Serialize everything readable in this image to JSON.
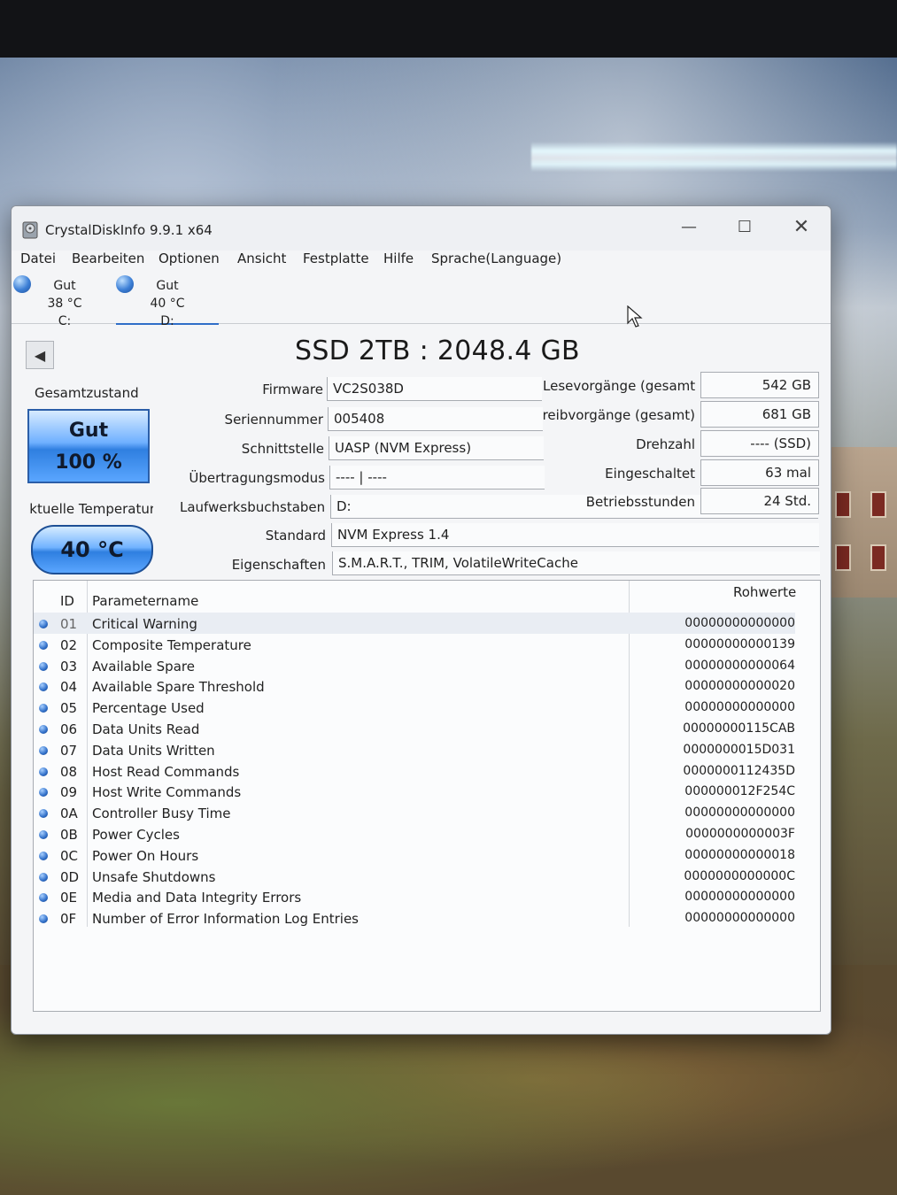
{
  "window": {
    "title": "CrystalDiskInfo 9.9.1 x64"
  },
  "controls": {
    "minimize": "—",
    "maximize": "☐",
    "close": "✕"
  },
  "menu": [
    "Datei",
    "Bearbeiten",
    "Optionen",
    "Ansicht",
    "Festplatte",
    "Hilfe",
    "Sprache(Language)"
  ],
  "drives": [
    {
      "status": "Gut",
      "temp": "38 °C",
      "letter": "C:"
    },
    {
      "status": "Gut",
      "temp": "40 °C",
      "letter": "D:"
    }
  ],
  "disk": {
    "title": "SSD 2TB : 2048.4 GB"
  },
  "health": {
    "label": "Gesamtzustand",
    "status": "Gut",
    "percent": "100 %"
  },
  "temperature": {
    "label": "Aktuelle Temperatur",
    "value": "40 °C"
  },
  "info_left": [
    {
      "label": "Firmware",
      "value": "VC2S038D"
    },
    {
      "label": "Seriennummer",
      "value": "005408"
    },
    {
      "label": "Schnittstelle",
      "value": "UASP (NVM Express)"
    },
    {
      "label": "Übertragungsmodus",
      "value": "---- | ----"
    },
    {
      "label": "Laufwerksbuchstaben",
      "value": "D:"
    },
    {
      "label": "Standard",
      "value": "NVM Express 1.4"
    },
    {
      "label": "Eigenschaften",
      "value": "S.M.A.R.T., TRIM, VolatileWriteCache"
    }
  ],
  "info_right": [
    {
      "label": "Lesevorgänge (gesamt)",
      "value": "542 GB"
    },
    {
      "label": "Schreibvorgänge (gesamt)",
      "value": "681 GB"
    },
    {
      "label": "Drehzahl",
      "value": "---- (SSD)"
    },
    {
      "label": "Eingeschaltet",
      "value": "63 mal"
    },
    {
      "label": "Betriebsstunden",
      "value": "24 Std."
    }
  ],
  "smart": {
    "headers": {
      "id": "ID",
      "name": "Parametername",
      "raw": "Rohwerte"
    },
    "rows": [
      {
        "id": "01",
        "name": "Critical Warning",
        "raw": "00000000000000"
      },
      {
        "id": "02",
        "name": "Composite Temperature",
        "raw": "00000000000139"
      },
      {
        "id": "03",
        "name": "Available Spare",
        "raw": "00000000000064"
      },
      {
        "id": "04",
        "name": "Available Spare Threshold",
        "raw": "00000000000020"
      },
      {
        "id": "05",
        "name": "Percentage Used",
        "raw": "00000000000000"
      },
      {
        "id": "06",
        "name": "Data Units Read",
        "raw": "00000000115CAB"
      },
      {
        "id": "07",
        "name": "Data Units Written",
        "raw": "0000000015D031"
      },
      {
        "id": "08",
        "name": "Host Read Commands",
        "raw": "0000000112435D"
      },
      {
        "id": "09",
        "name": "Host Write Commands",
        "raw": "000000012F254C"
      },
      {
        "id": "0A",
        "name": "Controller Busy Time",
        "raw": "00000000000000"
      },
      {
        "id": "0B",
        "name": "Power Cycles",
        "raw": "0000000000003F"
      },
      {
        "id": "0C",
        "name": "Power On Hours",
        "raw": "00000000000018"
      },
      {
        "id": "0D",
        "name": "Unsafe Shutdowns",
        "raw": "0000000000000C"
      },
      {
        "id": "0E",
        "name": "Media and Data Integrity Errors",
        "raw": "00000000000000"
      },
      {
        "id": "0F",
        "name": "Number of Error Information Log Entries",
        "raw": "00000000000000"
      }
    ]
  }
}
